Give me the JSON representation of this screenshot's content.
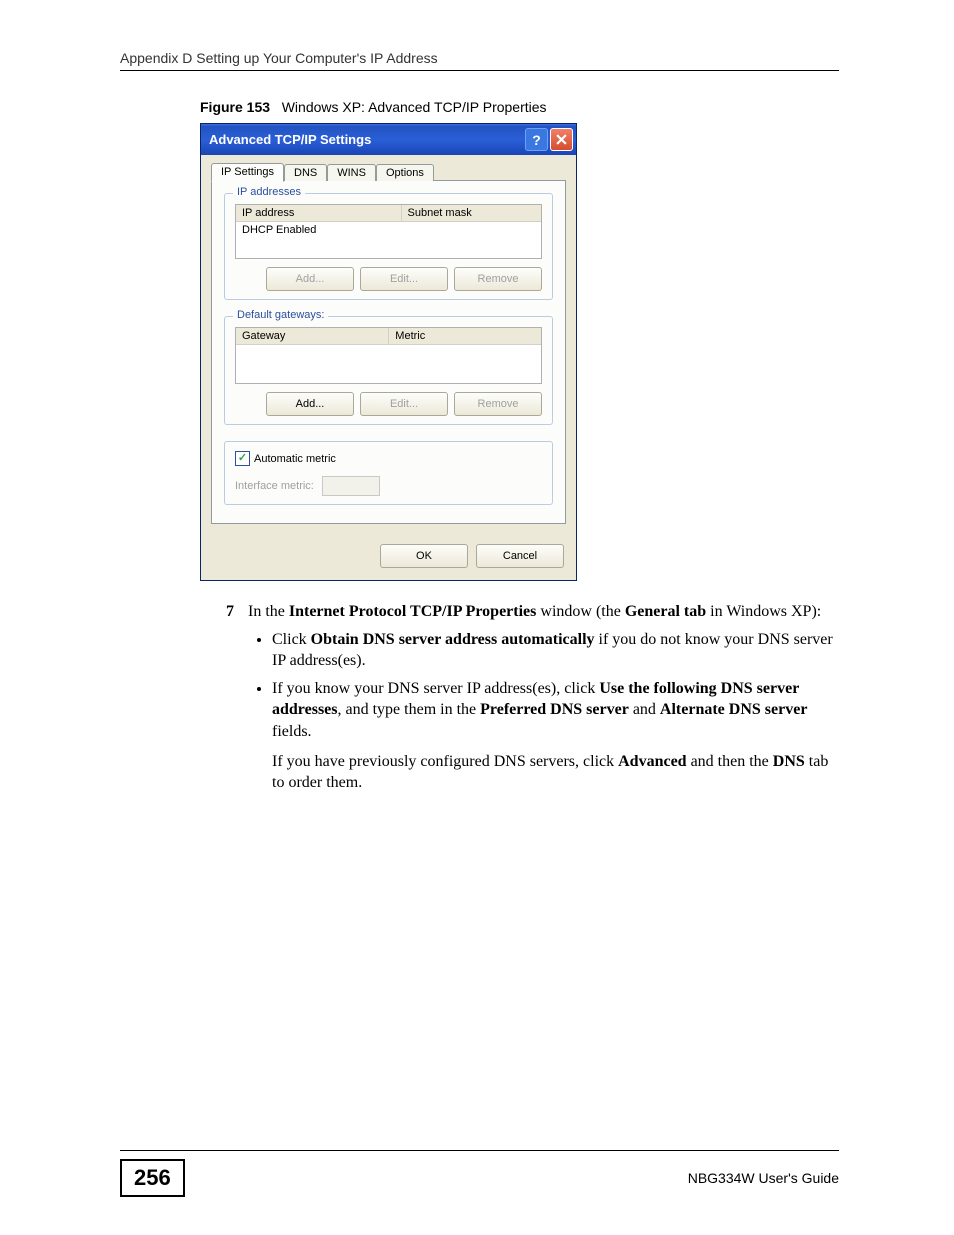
{
  "header": "Appendix D Setting up Your Computer's IP Address",
  "figure": {
    "num": "Figure 153",
    "caption": "Windows XP: Advanced TCP/IP Properties"
  },
  "dialog": {
    "title": "Advanced TCP/IP Settings",
    "tabs": {
      "ip_settings": "IP Settings",
      "dns": "DNS",
      "wins": "WINS",
      "options": "Options"
    },
    "ip_addresses": {
      "legend": "IP addresses",
      "col_ip": "IP address",
      "col_subnet": "Subnet mask",
      "row_value": "DHCP Enabled",
      "btn_add": "Add...",
      "btn_edit": "Edit...",
      "btn_remove": "Remove"
    },
    "gateways": {
      "legend": "Default gateways:",
      "col_gateway": "Gateway",
      "col_metric": "Metric",
      "btn_add": "Add...",
      "btn_edit": "Edit...",
      "btn_remove": "Remove"
    },
    "auto_metric_label": "Automatic metric",
    "interface_metric_label": "Interface metric:",
    "ok": "OK",
    "cancel": "Cancel"
  },
  "step": {
    "num": "7",
    "intro_1": "In the ",
    "intro_bold1": "Internet Protocol TCP/IP Properties",
    "intro_2": " window (the ",
    "intro_bold2": "General tab",
    "intro_3": " in Windows XP):",
    "b1_a": "Click ",
    "b1_bold": "Obtain DNS server address automatically",
    "b1_b": " if you do not know your DNS server IP address(es).",
    "b2_a": "If you know your DNS server IP address(es), click ",
    "b2_bold1": "Use the following DNS server addresses",
    "b2_b": ", and type them in the ",
    "b2_bold2": "Preferred DNS server",
    "b2_c": " and ",
    "b2_bold3": "Alternate DNS server",
    "b2_d": " fields.",
    "b2_p2a": "If you have previously configured DNS servers, click ",
    "b2_p2_bold1": "Advanced",
    "b2_p2b": " and then the ",
    "b2_p2_bold2": "DNS",
    "b2_p2c": " tab to order them."
  },
  "footer": {
    "page": "256",
    "guide": "NBG334W User's Guide"
  }
}
